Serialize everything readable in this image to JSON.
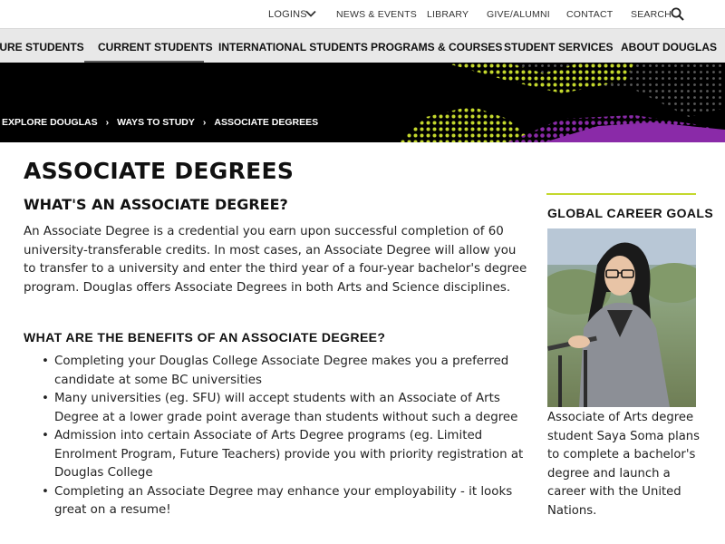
{
  "utility_nav": {
    "logins": "LOGINS",
    "news": "NEWS & EVENTS",
    "library": "LIBRARY",
    "give": "GIVE/ALUMNI",
    "contact": "CONTACT",
    "search": "SEARCH"
  },
  "main_nav": {
    "items": [
      {
        "label": "TURE STUDENTS"
      },
      {
        "label": "CURRENT STUDENTS"
      },
      {
        "label": "INTERNATIONAL STUDENTS"
      },
      {
        "label": "PROGRAMS & COURSES"
      },
      {
        "label": "STUDENT SERVICES"
      },
      {
        "label": "ABOUT DOUGLAS"
      }
    ],
    "active_index": 1
  },
  "breadcrumb": {
    "items": [
      "EXPLORE DOUGLAS",
      "WAYS TO STUDY",
      "ASSOCIATE DEGREES"
    ],
    "separator": "›"
  },
  "page": {
    "title": "ASSOCIATE DEGREES",
    "section_heading": "WHAT'S AN ASSOCIATE DEGREE?",
    "intro": "An Associate Degree is a credential you earn upon successful completion of 60 university-transferable credits. In most cases, an Associate Degree will allow you to transfer to a university and enter the third year of a four-year bachelor's degree program. Douglas offers Associate Degrees in both Arts and Science disciplines.",
    "benefits_heading": "WHAT ARE THE BENEFITS OF AN ASSOCIATE DEGREE?",
    "benefits": [
      "Completing your Douglas College Associate Degree makes you a preferred candidate at some BC universities",
      "Many universities (eg. SFU) will accept students with an Associate of Arts Degree at a lower grade point average than students without such a degree",
      "Admission into certain Associate of Arts Degree programs (eg. Limited Enrolment Program, Future Teachers) provide you with priority registration at Douglas College",
      "Completing an Associate Degree may enhance your employability - it looks great on a resume!"
    ]
  },
  "sidebar": {
    "heading": "GLOBAL CAREER GOALS",
    "caption": "Associate of Arts degree student Saya Soma plans to complete a bachelor's degree and launch a career with the United Nations."
  },
  "colors": {
    "accent_lime": "#c4d82d",
    "accent_purple": "#8a2aa8",
    "nav_bg": "#e8e8e8",
    "hero_bg": "#000000"
  },
  "icons": {
    "logins_chevron": "chevron-down-icon",
    "search": "search-icon"
  }
}
